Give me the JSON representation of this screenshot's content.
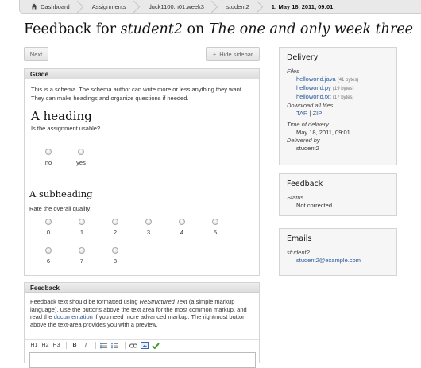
{
  "breadcrumb": [
    "Dashboard",
    "Assignments",
    "duck1100.h01.week3",
    "student2",
    "1: May 18, 2011, 09:01"
  ],
  "title": {
    "prefix": "Feedback for ",
    "student": "student2",
    "mid": " on ",
    "assignment": "The one and only week three"
  },
  "buttons": {
    "next": "Next",
    "hide_sidebar": "Hide sidebar"
  },
  "grade": {
    "header": "Grade",
    "intro": "This is a schema. The schema author can write more or less anything they want. They can make headings and organize questions if needed.",
    "heading": "A heading",
    "question1": "Is the assignment usable?",
    "options1": [
      "no",
      "yes"
    ],
    "subheading": "A subheading",
    "question2": "Rate the overall quality:",
    "options2": [
      "0",
      "1",
      "2",
      "3",
      "4",
      "5",
      "6",
      "7",
      "8"
    ]
  },
  "feedback": {
    "header": "Feedback",
    "text1": "Feedback text should be formatted using ",
    "rst": "ReStructured Text",
    "text2": " (a simple markup language). Use the buttons above the text area for the most common markup, and read the ",
    "doc_link": "documentation",
    "text3": " if you need more advanced markup. The rightmost button above the text-area provides you with a preview.",
    "toolbar": [
      "H1",
      "H2",
      "H3",
      "B",
      "I"
    ]
  },
  "sidebar": {
    "delivery": {
      "title": "Delivery",
      "files_label": "Files",
      "files": [
        {
          "name": "helloworld.java",
          "size": "(41 bytes)"
        },
        {
          "name": "helloworld.py",
          "size": "(19 bytes)"
        },
        {
          "name": "helloworld.txt",
          "size": "(17 bytes)"
        }
      ],
      "download_label": "Download all files",
      "tar": "TAR",
      "sep": "|",
      "zip": "ZIP",
      "time_label": "Time of delivery",
      "time": "May 18, 2011, 09:01",
      "by_label": "Delivered by",
      "by": "student2"
    },
    "feedback": {
      "title": "Feedback",
      "status_label": "Status",
      "status": "Not corrected"
    },
    "emails": {
      "title": "Emails",
      "label": "student2",
      "email": "student2@example.com"
    }
  },
  "colors": {
    "link": "#2a5a9a",
    "check": "#3a9a2a",
    "panel_head": "#dcdcdc"
  }
}
